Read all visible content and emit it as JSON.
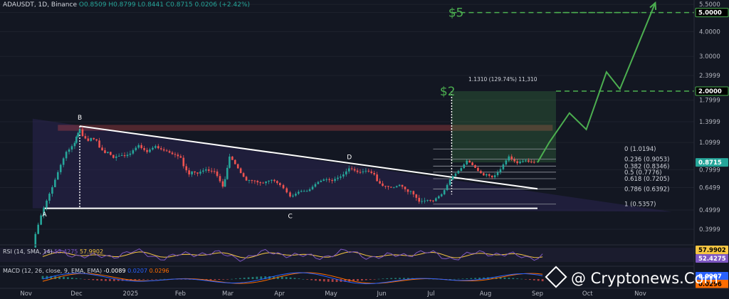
{
  "header": {
    "symbol": "ADAUSDT, 1D, Binance",
    "open": "O0.8509",
    "high": "H0.8799",
    "low": "L0.8441",
    "close": "C0.8715",
    "change": "0.0206 (+2.42%)"
  },
  "rsi_header": {
    "label": "RSI (14, SMA, 14)",
    "v1": "52.4275",
    "v2": "57.9902"
  },
  "macd_header": {
    "label": "MACD (12, 26, close, 9, EMA, EMA)",
    "v1": "-0.0089",
    "v2": "0.0207",
    "v3": "0.0296"
  },
  "watermark": "@ Cryptonews.Com",
  "colors": {
    "background": "#131722",
    "up": "#26a69a",
    "down": "#ef5350",
    "target": "#4caf50",
    "wedge": "#2a2550",
    "rsi": "#7e57c2",
    "macd": "#2962ff",
    "signal": "#ff6d00"
  },
  "chart_data": {
    "type": "candlestick",
    "log_scale": true,
    "ylim": [
      0.35,
      5.5
    ],
    "y_ticks": [
      "5.5000",
      "5.0000",
      "4.0000",
      "3.0000",
      "2.3999",
      "1.7999",
      "1.3999",
      "1.0999",
      "0.7999",
      "0.6499",
      "0.4999",
      "0.3999"
    ],
    "x_ticks": [
      "Nov",
      "Dec",
      "2025",
      "Feb",
      "Mar",
      "Apr",
      "May",
      "Jun",
      "Jul",
      "Aug",
      "Sep",
      "Oct",
      "Nov"
    ],
    "price_labels": [
      {
        "text": "5.0000",
        "value": 5.0,
        "style": "outline"
      },
      {
        "text": "2.0000",
        "value": 2.0,
        "style": "outline"
      },
      {
        "text": "0.8715",
        "value": 0.8715,
        "style": "current"
      },
      {
        "text": "57.9902",
        "style": "rsi-sma"
      },
      {
        "text": "52.4275",
        "style": "rsi"
      },
      {
        "text": "0.0207",
        "style": "macd"
      },
      {
        "text": "0.0296",
        "style": "signal"
      }
    ],
    "targets": [
      {
        "label": "$5",
        "value": 5.0
      },
      {
        "label": "$2",
        "value": 2.0
      }
    ],
    "measure_label": "1.1310 (129.74%) 11,310",
    "fib_levels": [
      {
        "label": "0 (1.0194)",
        "value": 1.0194
      },
      {
        "label": "0.236 (0.9053)",
        "value": 0.9053
      },
      {
        "label": "0.382 (0.8346)",
        "value": 0.8346
      },
      {
        "label": "0.5 (0.7776)",
        "value": 0.7776
      },
      {
        "label": "0.618 (0.7205)",
        "value": 0.7205
      },
      {
        "label": "0.786 (0.6392)",
        "value": 0.6392
      },
      {
        "label": "1 (0.5357)",
        "value": 0.5357
      }
    ],
    "pattern_points": [
      {
        "label": "A",
        "date": "2024-11-12",
        "value": 0.53
      },
      {
        "label": "B",
        "date": "2024-12-03",
        "value": 1.33
      },
      {
        "label": "C",
        "date": "2025-04-07",
        "value": 0.52
      },
      {
        "label": "D",
        "date": "2025-05-12",
        "value": 0.84
      }
    ],
    "resistance_zone": [
      1.26,
      1.35
    ],
    "projection": [
      {
        "date": "2025-09-01",
        "value": 0.87
      },
      {
        "date": "2025-09-08",
        "value": 1.1
      },
      {
        "date": "2025-09-20",
        "value": 1.55
      },
      {
        "date": "2025-09-30",
        "value": 1.28
      },
      {
        "date": "2025-10-12",
        "value": 2.5
      },
      {
        "date": "2025-10-20",
        "value": 2.05
      },
      {
        "date": "2025-11-10",
        "value": 5.6
      }
    ],
    "series": [
      {
        "name": "ADAUSDT",
        "points": [
          [
            "2024-11-05",
            0.34
          ],
          [
            "2024-11-10",
            0.47
          ],
          [
            "2024-11-15",
            0.6
          ],
          [
            "2024-11-20",
            0.78
          ],
          [
            "2024-11-25",
            0.98
          ],
          [
            "2024-11-30",
            1.1
          ],
          [
            "2024-12-03",
            1.25
          ],
          [
            "2024-12-08",
            1.15
          ],
          [
            "2024-12-13",
            1.1
          ],
          [
            "2024-12-18",
            1.0
          ],
          [
            "2024-12-23",
            0.9
          ],
          [
            "2024-12-28",
            0.92
          ],
          [
            "2025-01-02",
            0.96
          ],
          [
            "2025-01-07",
            1.05
          ],
          [
            "2025-01-12",
            0.98
          ],
          [
            "2025-01-17",
            1.04
          ],
          [
            "2025-01-22",
            1.0
          ],
          [
            "2025-01-27",
            0.95
          ],
          [
            "2025-02-01",
            0.9
          ],
          [
            "2025-02-06",
            0.78
          ],
          [
            "2025-02-11",
            0.75
          ],
          [
            "2025-02-16",
            0.78
          ],
          [
            "2025-02-21",
            0.77
          ],
          [
            "2025-02-26",
            0.64
          ],
          [
            "2025-03-02",
            0.95
          ],
          [
            "2025-03-07",
            0.82
          ],
          [
            "2025-03-12",
            0.72
          ],
          [
            "2025-03-17",
            0.71
          ],
          [
            "2025-03-22",
            0.7
          ],
          [
            "2025-03-27",
            0.72
          ],
          [
            "2025-04-01",
            0.67
          ],
          [
            "2025-04-07",
            0.58
          ],
          [
            "2025-04-12",
            0.62
          ],
          [
            "2025-04-17",
            0.62
          ],
          [
            "2025-04-22",
            0.68
          ],
          [
            "2025-04-27",
            0.71
          ],
          [
            "2025-05-02",
            0.69
          ],
          [
            "2025-05-07",
            0.72
          ],
          [
            "2025-05-12",
            0.8
          ],
          [
            "2025-05-17",
            0.76
          ],
          [
            "2025-05-22",
            0.78
          ],
          [
            "2025-05-27",
            0.74
          ],
          [
            "2025-06-01",
            0.68
          ],
          [
            "2025-06-06",
            0.66
          ],
          [
            "2025-06-11",
            0.69
          ],
          [
            "2025-06-16",
            0.63
          ],
          [
            "2025-06-21",
            0.56
          ],
          [
            "2025-06-26",
            0.57
          ],
          [
            "2025-07-01",
            0.56
          ],
          [
            "2025-07-06",
            0.6
          ],
          [
            "2025-07-11",
            0.72
          ],
          [
            "2025-07-16",
            0.79
          ],
          [
            "2025-07-21",
            0.9
          ],
          [
            "2025-07-26",
            0.82
          ],
          [
            "2025-07-31",
            0.76
          ],
          [
            "2025-08-05",
            0.72
          ],
          [
            "2025-08-10",
            0.8
          ],
          [
            "2025-08-15",
            0.92
          ],
          [
            "2025-08-20",
            0.86
          ],
          [
            "2025-08-25",
            0.88
          ],
          [
            "2025-08-30",
            0.8715
          ]
        ]
      }
    ]
  }
}
